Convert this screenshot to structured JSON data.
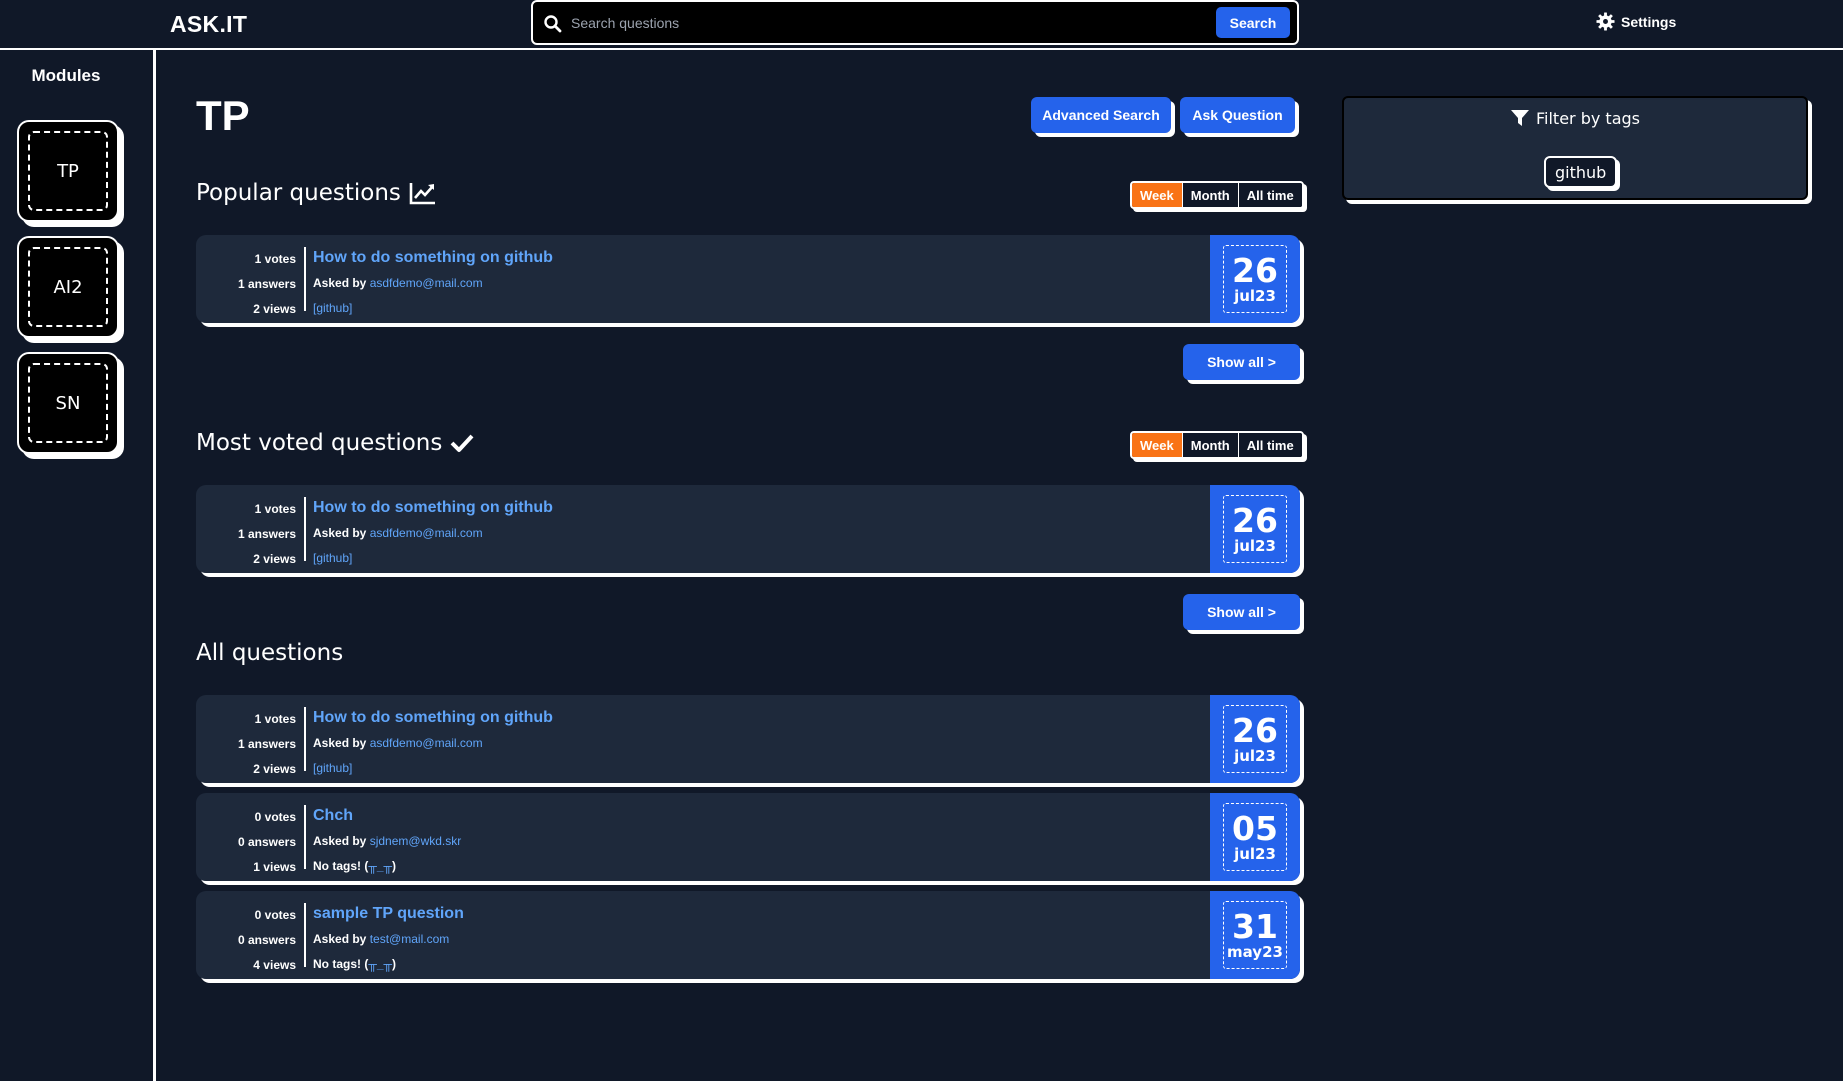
{
  "header": {
    "brand": "ASK.IT",
    "search_placeholder": "Search questions",
    "search_button": "Search",
    "settings_label": "Settings"
  },
  "sidebar": {
    "title": "Modules",
    "modules": [
      {
        "label": "TP"
      },
      {
        "label": "AI2"
      },
      {
        "label": "SN"
      }
    ]
  },
  "main": {
    "page_title": "TP",
    "advanced_search_button": "Advanced Search",
    "ask_question_button": "Ask Question",
    "show_all_label": "Show all >",
    "period_options": [
      "Week",
      "Month",
      "All time"
    ],
    "selected_period": "Week",
    "sections": [
      {
        "title": "Popular questions",
        "icon": "chart-line-icon",
        "questions": [
          {
            "votes": "1 votes",
            "answers": "1 answers",
            "views": "2 views",
            "title": "How to do something on github",
            "asked_by_label": "Asked by",
            "author": "asdfdemo@mail.com",
            "tags": "[github]",
            "day": "26",
            "month": "jul23"
          }
        ]
      },
      {
        "title": "Most voted questions",
        "icon": "check-icon",
        "questions": [
          {
            "votes": "1 votes",
            "answers": "1 answers",
            "views": "2 views",
            "title": "How to do something on github",
            "asked_by_label": "Asked by",
            "author": "asdfdemo@mail.com",
            "tags": "[github]",
            "day": "26",
            "month": "jul23"
          }
        ]
      },
      {
        "title": "All questions",
        "questions": [
          {
            "votes": "1 votes",
            "answers": "1 answers",
            "views": "2 views",
            "title": "How to do something on github",
            "asked_by_label": "Asked by",
            "author": "asdfdemo@mail.com",
            "tags": "[github]",
            "day": "26",
            "month": "jul23"
          },
          {
            "votes": "0 votes",
            "answers": "0 answers",
            "views": "1 views",
            "title": "Chch",
            "asked_by_label": "Asked by",
            "author": "sjdnem@wkd.skr",
            "no_tags_label": "No tags! (",
            "emoticon": "╥_╥",
            "no_tags_close": ")",
            "day": "05",
            "month": "jul23"
          },
          {
            "votes": "0 votes",
            "answers": "0 answers",
            "views": "4 views",
            "title": "sample TP question",
            "asked_by_label": "Asked by",
            "author": "test@mail.com",
            "no_tags_label": "No tags! (",
            "emoticon": "╥_╥",
            "no_tags_close": ")",
            "day": "31",
            "month": "may23"
          }
        ]
      }
    ]
  },
  "filter": {
    "title": "Filter by tags",
    "tags": [
      "github"
    ]
  },
  "colors": {
    "background": "#101828",
    "card": "#1e293b",
    "accent": "#2563eb",
    "active_period": "#f97316",
    "link": "#60a5fa"
  }
}
